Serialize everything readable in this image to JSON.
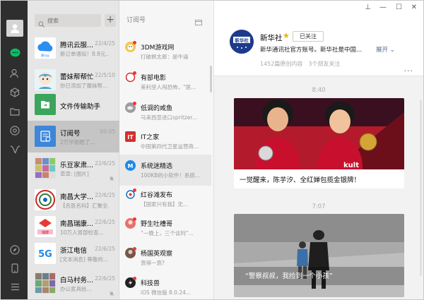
{
  "search": {
    "placeholder": "搜索"
  },
  "add_label": "+",
  "chats": [
    {
      "name": "腾讯云服...",
      "time": "22/4/25",
      "preview": "新订单通知！8.8元...",
      "muted": false
    },
    {
      "name": "蕾妹帮帮忙",
      "time": "22/5/10",
      "preview": "你已添加了蕾妹帮...",
      "muted": false
    },
    {
      "name": "文件传输助手",
      "time": "",
      "preview": "",
      "muted": false
    },
    {
      "name": "订阅号",
      "time": "09:05",
      "preview": "2万学姐晒了...",
      "muted": false,
      "selected": true
    },
    {
      "name": "乐豆家肃...",
      "time": "22/6/25",
      "preview": "草草: [图片]",
      "muted": true
    },
    {
      "name": "南昌大学...",
      "time": "22/6/25",
      "preview": "【名医名科】汇聚全...",
      "muted": false
    },
    {
      "name": "南昌瑞康...",
      "time": "22/6/25",
      "preview": "10万人胃部检查...",
      "muted": false
    },
    {
      "name": "浙江电信",
      "time": "22/6/25",
      "preview": "[文本消息] 尊敬的...",
      "muted": false
    },
    {
      "name": "白马村务...",
      "time": "22/6/25",
      "preview": "办公家具给...",
      "muted": true
    }
  ],
  "subs_title": "订阅号",
  "subs": [
    {
      "name": "3DM游戏网",
      "preview": "打破枫太郎：是牛逼"
    },
    {
      "name": "有部电影",
      "preview": "美利坚人闯恐怖，“医..."
    },
    {
      "name": "低调的咸鱼",
      "preview": "马来西亚进口spritzer..."
    },
    {
      "name": "IT之家",
      "preview": "中国第四代卫星运营商..."
    },
    {
      "name": "系统迷精选",
      "preview": "100KB的小软件！系统..."
    },
    {
      "name": "红谷滩发布",
      "preview": "【国家兴有我】无..."
    },
    {
      "name": "野生吐槽哥",
      "preview": "“一晚上，三个谈判”..."
    },
    {
      "name": "杨国英观察",
      "preview": "衰得一衰?"
    },
    {
      "name": "科技兽",
      "preview": "iOS 微信版 8.0.24..."
    }
  ],
  "win": {
    "pin": "⊥",
    "min": "—",
    "max": "☐",
    "close": "✕"
  },
  "account": {
    "logo_text": "新华社",
    "name": "新华社",
    "star": "★",
    "follow_label": "已关注",
    "desc": "新华通讯社官方账号。新华社是中国...",
    "expand_label": "展开",
    "stats": "1452篇原创内容　3个朋友关注",
    "more": "···"
  },
  "feed": [
    {
      "time": "8:40",
      "caption": "一觉醒来，陈芋汐、全红婵包揽金银牌！",
      "img_label": "kult"
    },
    {
      "time": "7:07",
      "overlay": "“警察叔叔，我捡到一个小孩”"
    }
  ],
  "colors": {
    "rail": "#2e2e2e",
    "list": "#e6e6e6",
    "selected": "#c6c5c5",
    "link": "#576b95",
    "badge": "#f43530"
  }
}
